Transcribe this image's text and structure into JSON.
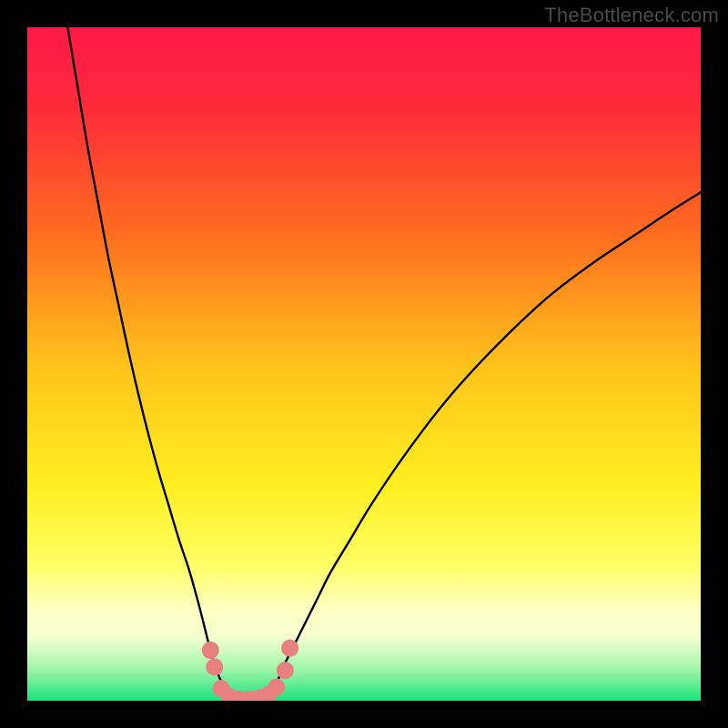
{
  "watermark": "TheBottleneck.com",
  "chart_data": {
    "type": "line",
    "title": "",
    "xlabel": "",
    "ylabel": "",
    "xlim": [
      0,
      100
    ],
    "ylim": [
      0,
      100
    ],
    "grid": false,
    "legend": false,
    "gradient_stops": [
      {
        "offset": 0.0,
        "color": "#ff1846"
      },
      {
        "offset": 0.12,
        "color": "#ff2b3a"
      },
      {
        "offset": 0.3,
        "color": "#ff6a1f"
      },
      {
        "offset": 0.5,
        "color": "#ffc21a"
      },
      {
        "offset": 0.68,
        "color": "#ffef20"
      },
      {
        "offset": 0.8,
        "color": "#ffff66"
      },
      {
        "offset": 0.86,
        "color": "#ffffc0"
      },
      {
        "offset": 0.905,
        "color": "#f6ffd0"
      },
      {
        "offset": 0.955,
        "color": "#9cf5a8"
      },
      {
        "offset": 1.0,
        "color": "#1be37a"
      }
    ],
    "series": [
      {
        "name": "left-branch",
        "x": [
          6.0,
          7.5,
          9.0,
          10.5,
          12.0,
          13.5,
          15.0,
          16.5,
          18.0,
          19.5,
          21.0,
          22.5,
          24.0,
          25.0,
          25.8,
          26.5,
          27.2,
          28.0,
          29.0,
          30.5
        ],
        "y": [
          100.0,
          91.0,
          82.0,
          74.0,
          66.0,
          59.0,
          52.0,
          45.5,
          39.5,
          34.0,
          29.0,
          24.0,
          19.5,
          16.0,
          13.0,
          10.2,
          7.5,
          4.8,
          2.5,
          0.5
        ]
      },
      {
        "name": "right-branch",
        "x": [
          36.0,
          37.0,
          38.0,
          39.5,
          41.0,
          43.0,
          45.0,
          48.0,
          51.0,
          55.0,
          59.0,
          63.0,
          68.0,
          73.0,
          78.0,
          84.0,
          90.0,
          96.0,
          100.0
        ],
        "y": [
          0.5,
          2.5,
          5.0,
          8.0,
          11.0,
          15.0,
          19.0,
          24.0,
          29.0,
          35.0,
          40.5,
          45.5,
          51.0,
          56.0,
          60.5,
          65.0,
          69.0,
          73.0,
          75.5
        ]
      }
    ],
    "markers": {
      "name": "bottom-dots",
      "color": "#e98080",
      "points": [
        {
          "x": 27.2,
          "y": 7.5
        },
        {
          "x": 27.8,
          "y": 5.0
        },
        {
          "x": 28.8,
          "y": 1.8
        },
        {
          "x": 30.0,
          "y": 0.6
        },
        {
          "x": 31.5,
          "y": 0.2
        },
        {
          "x": 33.0,
          "y": 0.2
        },
        {
          "x": 34.5,
          "y": 0.4
        },
        {
          "x": 35.8,
          "y": 0.9
        },
        {
          "x": 37.0,
          "y": 2.0
        },
        {
          "x": 38.3,
          "y": 4.5
        },
        {
          "x": 39.0,
          "y": 7.8
        }
      ]
    }
  }
}
